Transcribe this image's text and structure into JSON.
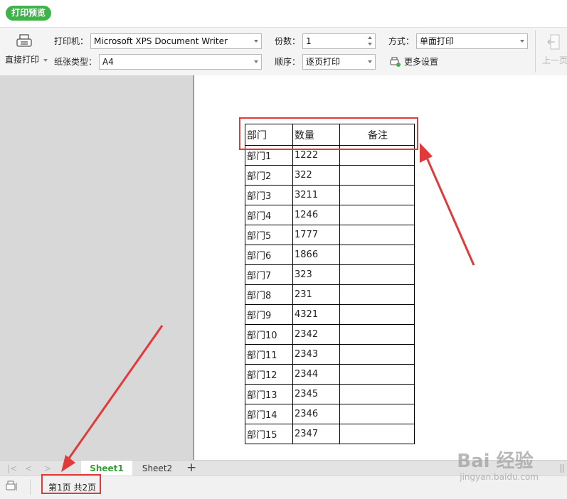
{
  "preview_title": "打印预览",
  "toolbar": {
    "direct_print": "直接打印",
    "printer_label": "打印机：",
    "printer_value": "Microsoft XPS Document Writer",
    "paper_label": "纸张类型：",
    "paper_value": "A4",
    "copies_label": "份数：",
    "copies_value": "1",
    "order_label": "顺序：",
    "order_value": "逐页打印",
    "mode_label": "方式：",
    "mode_value": "单面打印",
    "more_settings": "更多设置",
    "prev_page": "上一页"
  },
  "table": {
    "headers": [
      "部门",
      "数量",
      "备注"
    ],
    "rows": [
      [
        "部门1",
        "1222",
        ""
      ],
      [
        "部门2",
        "322",
        ""
      ],
      [
        "部门3",
        "3211",
        ""
      ],
      [
        "部门4",
        "1246",
        ""
      ],
      [
        "部门5",
        "1777",
        ""
      ],
      [
        "部门6",
        "1866",
        ""
      ],
      [
        "部门7",
        "323",
        ""
      ],
      [
        "部门8",
        "231",
        ""
      ],
      [
        "部门9",
        "4321",
        ""
      ],
      [
        "部门10",
        "2342",
        ""
      ],
      [
        "部门11",
        "2343",
        ""
      ],
      [
        "部门12",
        "2344",
        ""
      ],
      [
        "部门13",
        "2345",
        ""
      ],
      [
        "部门14",
        "2346",
        ""
      ],
      [
        "部门15",
        "2347",
        ""
      ]
    ]
  },
  "tabs": [
    "Sheet1",
    "Sheet2"
  ],
  "status": "第1页 共2页",
  "watermark": {
    "brand": "Bai  经验",
    "url": "jingyan.baidu.com"
  },
  "colors": {
    "accent_green": "#3db34a",
    "annotation_red": "#e03a3a"
  }
}
